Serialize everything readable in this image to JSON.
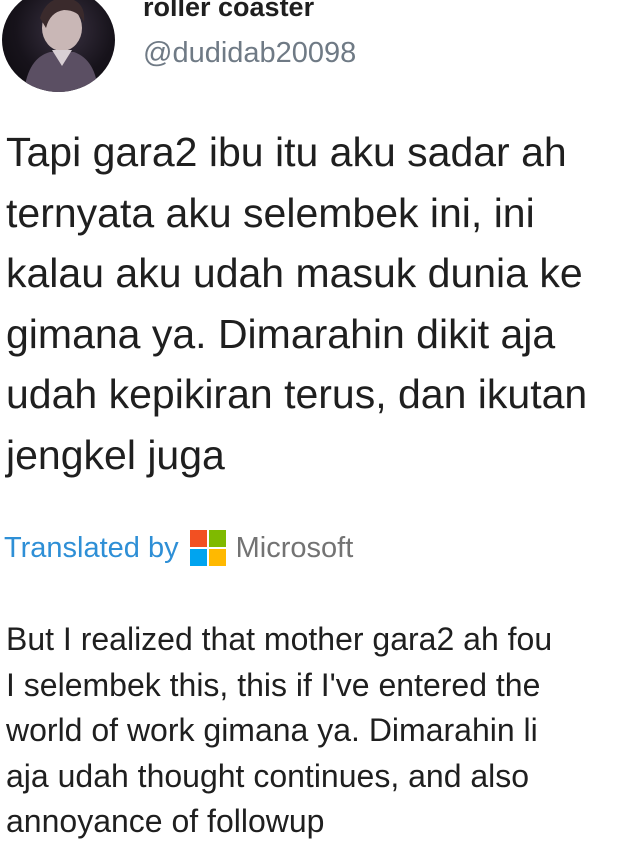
{
  "author": {
    "display_name": "roller coaster",
    "handle": "@dudidab20098",
    "avatar_icon": "profile-photo"
  },
  "tweet": {
    "lines": [
      "Tapi gara2 ibu itu aku sadar ah",
      "ternyata aku selembek ini, ini",
      "kalau aku udah masuk dunia ke",
      "gimana ya. Dimarahin dikit aja",
      "udah kepikiran terus, dan ikutan",
      "jengkel juga"
    ]
  },
  "translation": {
    "label": "Translated by",
    "provider": "Microsoft",
    "provider_logo_colors": [
      "#f25022",
      "#7fba00",
      "#00a4ef",
      "#ffb900"
    ],
    "label_color": "#2e8fd6",
    "lines": [
      "But I realized that mother gara2 ah fou",
      "I selembek this, this if I've entered the",
      "world of work gimana ya. Dimarahin li",
      "aja udah thought continues, and also",
      "annoyance of followup"
    ]
  }
}
